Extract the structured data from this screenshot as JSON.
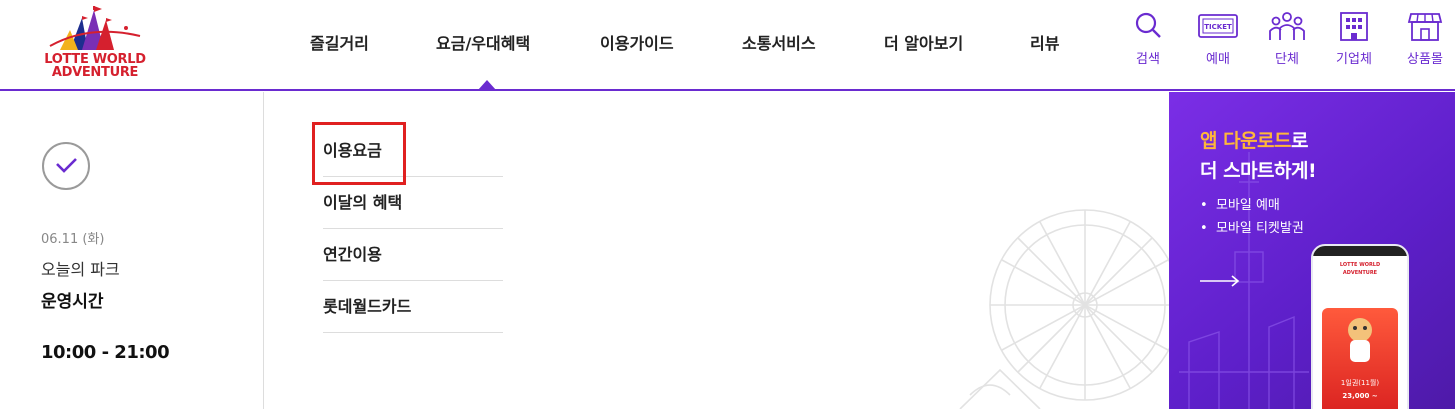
{
  "brand": {
    "logo_line1": "LOTTE WORLD",
    "logo_line2": "ADVENTURE"
  },
  "gnb": {
    "items": [
      {
        "label": "즐길거리"
      },
      {
        "label": "요금/우대혜택"
      },
      {
        "label": "이용가이드"
      },
      {
        "label": "소통서비스"
      },
      {
        "label": "더 알아보기"
      },
      {
        "label": "리뷰"
      }
    ],
    "active_index": 1
  },
  "util": {
    "search": "검색",
    "ticket": "예매",
    "group": "단체",
    "corporate": "기업체",
    "shop": "상품몰",
    "ticket_icon_text": "TICKET"
  },
  "park": {
    "date": "06.11 (화)",
    "park_label": "오늘의 파크",
    "hours_label": "운영시간",
    "hours": "10:00 - 21:00"
  },
  "submenu": {
    "items": [
      {
        "label": "이용요금"
      },
      {
        "label": "이달의 혜택"
      },
      {
        "label": "연간이용"
      },
      {
        "label": "롯데월드카드"
      }
    ]
  },
  "banner": {
    "title_highlight": "앱 다운로드",
    "title_rest": "로",
    "title_line2": "더 스마트하게!",
    "bullet1": "모바일 예매",
    "bullet2": "모바일 티켓발권",
    "phone_ticket": "1일권(11월)",
    "phone_price": "23,000 ~"
  },
  "colors": {
    "brand_purple": "#6a2bd0",
    "highlight_red": "#e02020",
    "banner_accent": "#ffb739"
  }
}
